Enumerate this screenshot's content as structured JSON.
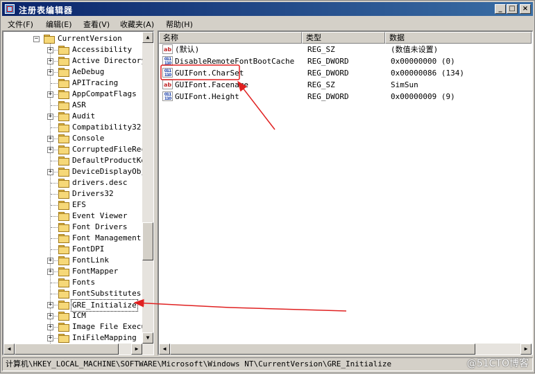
{
  "window": {
    "title": "注册表编辑器",
    "buttons": {
      "minimize": "_",
      "maximize": "□",
      "close": "×"
    }
  },
  "menu": [
    "文件(F)",
    "编辑(E)",
    "查看(V)",
    "收藏夹(A)",
    "帮助(H)"
  ],
  "tree": {
    "parent": "CurrentVersion",
    "items": [
      {
        "label": "Accessibility",
        "expandable": true
      },
      {
        "label": "Active Directory",
        "expandable": true
      },
      {
        "label": "AeDebug",
        "expandable": true
      },
      {
        "label": "APITracing",
        "expandable": false
      },
      {
        "label": "AppCompatFlags",
        "expandable": true
      },
      {
        "label": "ASR",
        "expandable": false
      },
      {
        "label": "Audit",
        "expandable": true
      },
      {
        "label": "Compatibility32",
        "expandable": false
      },
      {
        "label": "Console",
        "expandable": true
      },
      {
        "label": "CorruptedFileReco",
        "expandable": true
      },
      {
        "label": "DefaultProductKey",
        "expandable": false
      },
      {
        "label": "DeviceDisplayObje",
        "expandable": true
      },
      {
        "label": "drivers.desc",
        "expandable": false
      },
      {
        "label": "Drivers32",
        "expandable": false
      },
      {
        "label": "EFS",
        "expandable": false
      },
      {
        "label": "Event Viewer",
        "expandable": false
      },
      {
        "label": "Font Drivers",
        "expandable": false
      },
      {
        "label": "Font Management",
        "expandable": false
      },
      {
        "label": "FontDPI",
        "expandable": false
      },
      {
        "label": "FontLink",
        "expandable": true
      },
      {
        "label": "FontMapper",
        "expandable": true
      },
      {
        "label": "Fonts",
        "expandable": false
      },
      {
        "label": "FontSubstitutes",
        "expandable": false
      },
      {
        "label": "GRE_Initialize",
        "expandable": true,
        "selected": true
      },
      {
        "label": "ICM",
        "expandable": true
      },
      {
        "label": "Image File Execut",
        "expandable": true
      },
      {
        "label": "IniFileMapping",
        "expandable": true
      }
    ]
  },
  "list": {
    "columns": [
      "名称",
      "类型",
      "数据"
    ],
    "rows": [
      {
        "icon": "string-value-icon",
        "name": "(默认)",
        "type": "REG_SZ",
        "data": "(数值未设置)"
      },
      {
        "icon": "dword-value-icon",
        "name": "DisableRemoteFontBootCache",
        "type": "REG_DWORD",
        "data": "0x00000000 (0)"
      },
      {
        "icon": "dword-value-icon",
        "name": "GUIFont.CharSet",
        "type": "REG_DWORD",
        "data": "0x00000086 (134)",
        "highlighted": true
      },
      {
        "icon": "string-value-icon",
        "name": "GUIFont.Facename",
        "type": "REG_SZ",
        "data": "SimSun"
      },
      {
        "icon": "dword-value-icon",
        "name": "GUIFont.Height",
        "type": "REG_DWORD",
        "data": "0x00000009 (9)"
      }
    ]
  },
  "status": {
    "path": "计算机\\HKEY_LOCAL_MACHINE\\SOFTWARE\\Microsoft\\Windows NT\\CurrentVersion\\GRE_Initialize"
  },
  "watermark": "@51CTO博客",
  "icon_labels": {
    "string": "ab",
    "dword": "011\n110"
  },
  "colors": {
    "annotation_red": "#e02020",
    "titlebar": "#0a246a",
    "face": "#d4d0c8"
  }
}
